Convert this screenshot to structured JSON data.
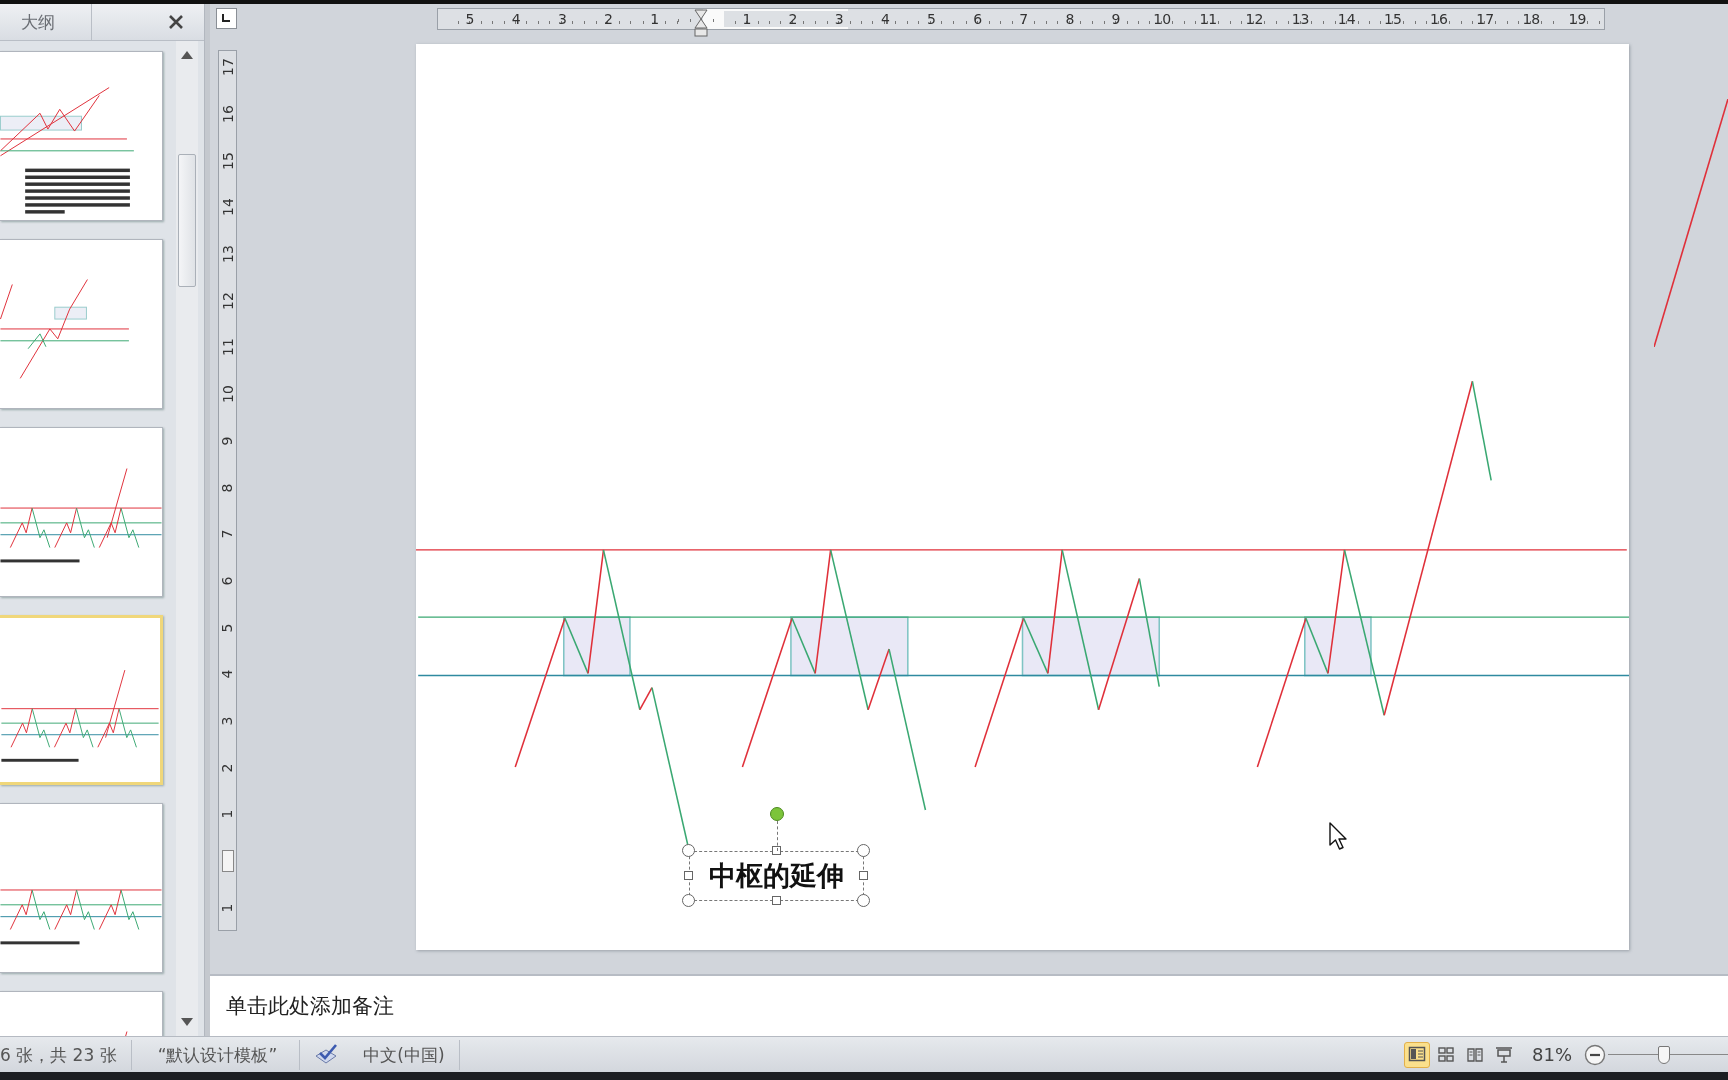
{
  "outline_panel": {
    "tabs": [
      {
        "label": "大纲",
        "selected": false
      }
    ]
  },
  "slides": [
    {
      "selected": false
    },
    {
      "selected": false
    },
    {
      "selected": false
    },
    {
      "selected": true
    },
    {
      "selected": false
    },
    {
      "selected": false
    }
  ],
  "ruler_top": {
    "left_labels": [
      "5",
      "4",
      "3",
      "2",
      "1"
    ],
    "right_labels": [
      "1",
      "2",
      "3",
      "4",
      "5",
      "6",
      "7",
      "8",
      "9",
      "10",
      "11",
      "12",
      "13",
      "14",
      "15",
      "16",
      "17",
      "18",
      "19"
    ]
  },
  "ruler_left": {
    "upper_labels": [
      "17",
      "16",
      "15",
      "14",
      "13",
      "12",
      "11",
      "10",
      "9",
      "8",
      "7",
      "6",
      "5",
      "4",
      "3",
      "2",
      "1"
    ],
    "lower_labels": [
      "1"
    ]
  },
  "slide": {
    "textbox": {
      "text": "中枢的延伸",
      "selected": true
    }
  },
  "notes": {
    "prompt": "单击此处添加备注"
  },
  "status_bar": {
    "slide_counter": "6 张，共 23 张",
    "theme": "“默认设计模板”",
    "language": "中文(中国)",
    "views": [
      {
        "kind": "normal",
        "selected": true
      },
      {
        "kind": "sorter",
        "selected": false
      },
      {
        "kind": "reading",
        "selected": false
      },
      {
        "kind": "slideshow",
        "selected": false
      }
    ],
    "zoom": "81%",
    "zoom_slider": {
      "level": 0.47
    }
  }
}
